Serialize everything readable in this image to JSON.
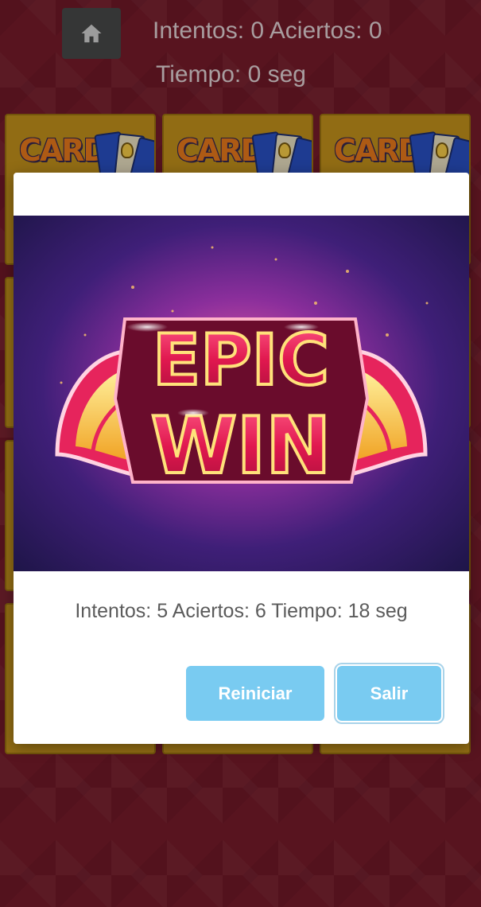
{
  "header": {
    "home_icon": "home-icon",
    "stats_line_1": "Intentos: 0 Aciertos: 0",
    "stats_line_2": "Tiempo: 0 seg"
  },
  "cards": {
    "face_word": "CARD",
    "face_icon": "lightbulb-icon"
  },
  "modal": {
    "image_text_line_1": "EPIC",
    "image_text_line_2": "WIN",
    "result_text": "Intentos: 5 Aciertos: 6 Tiempo: 18 seg",
    "restart_label": "Reiniciar",
    "exit_label": "Salir"
  },
  "colors": {
    "background": "#7a1c2c",
    "card": "#c9961c",
    "button": "#79cbf1",
    "header_button": "#4a4b4c"
  }
}
